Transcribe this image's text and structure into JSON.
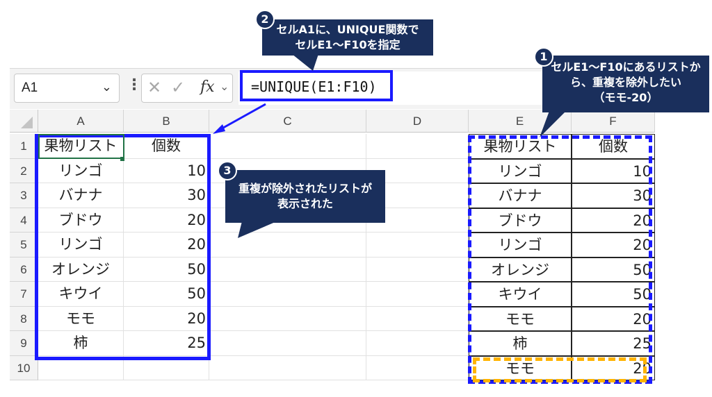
{
  "formula_bar": {
    "name_box": "A1",
    "formula": "=UNIQUE(E1:F10)"
  },
  "columns": [
    "A",
    "B",
    "C",
    "D",
    "E",
    "F"
  ],
  "rows": [
    "1",
    "2",
    "3",
    "4",
    "5",
    "6",
    "7",
    "8",
    "9",
    "10"
  ],
  "result_table": {
    "header": [
      "果物リスト",
      "個数"
    ],
    "rows": [
      [
        "リンゴ",
        "10"
      ],
      [
        "バナナ",
        "30"
      ],
      [
        "ブドウ",
        "20"
      ],
      [
        "リンゴ",
        "20"
      ],
      [
        "オレンジ",
        "50"
      ],
      [
        "キウイ",
        "50"
      ],
      [
        "モモ",
        "20"
      ],
      [
        "柿",
        "25"
      ]
    ]
  },
  "source_table": {
    "header": [
      "果物リスト",
      "個数"
    ],
    "rows": [
      [
        "リンゴ",
        "10"
      ],
      [
        "バナナ",
        "30"
      ],
      [
        "ブドウ",
        "20"
      ],
      [
        "リンゴ",
        "20"
      ],
      [
        "オレンジ",
        "50"
      ],
      [
        "キウイ",
        "50"
      ],
      [
        "モモ",
        "20"
      ],
      [
        "柿",
        "25"
      ],
      [
        "モモ",
        "20"
      ]
    ]
  },
  "callouts": {
    "c1": {
      "num": "1",
      "lines": [
        "セルE1～F10にあるリストか",
        "ら、重複を除外したい",
        "（モモ-20）"
      ]
    },
    "c2": {
      "num": "2",
      "lines": [
        "セルA1に、UNIQUE関数で",
        "セルE1～F10を指定"
      ]
    },
    "c3": {
      "num": "3",
      "lines": [
        "重複が除外されたリストが",
        "表示された"
      ]
    }
  },
  "colors": {
    "highlight_blue": "#1a1aff",
    "highlight_orange": "#ffb300",
    "callout_navy": "#1a2f5c"
  }
}
